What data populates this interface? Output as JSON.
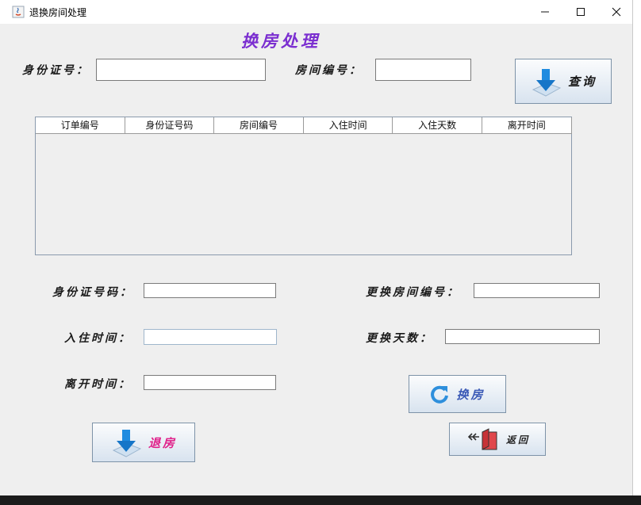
{
  "window": {
    "title": "退换房间处理",
    "controls": [
      "minimize",
      "maximize",
      "close"
    ]
  },
  "header": {
    "title": "换房处理"
  },
  "search": {
    "id_label": "身份证号：",
    "id_value": "",
    "room_label": "房间编号：",
    "room_value": "",
    "query_button": "查询"
  },
  "table": {
    "columns": [
      "订单编号",
      "身份证号码",
      "房间编号",
      "入住时间",
      "入住天数",
      "离开时间"
    ],
    "rows": []
  },
  "form": {
    "id_label": "身份证号码：",
    "id_value": "",
    "checkin_label": "入住时间：",
    "checkin_value": "",
    "leave_label": "离开时间：",
    "leave_value": "",
    "new_room_label": "更换房间编号：",
    "new_room_value": "",
    "days_label": "更换天数：",
    "days_value": ""
  },
  "actions": {
    "change_room": "换房",
    "checkout": "退房",
    "back": "返回"
  },
  "colors": {
    "title": "#7b2fd0",
    "checkout_text": "#e0208a",
    "change_text": "#3a59b6",
    "back_text": "#222222"
  }
}
